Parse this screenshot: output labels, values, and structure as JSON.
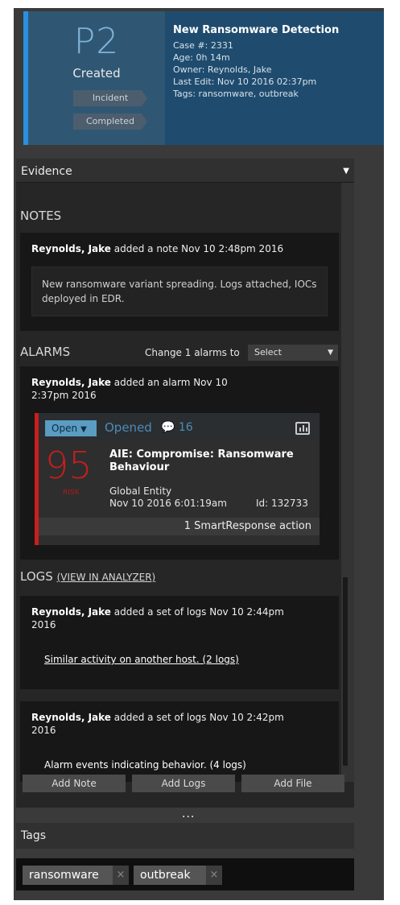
{
  "header": {
    "priority": "P2",
    "status": "Created",
    "chips": [
      "Incident",
      "Completed"
    ],
    "title": "New Ransomware Detection",
    "case_line": "Case #: 2331",
    "age_line": "Age: 0h 14m",
    "owner_line": "Owner: Reynolds, Jake",
    "last_edit_line": "Last Edit: Nov 10 2016 02:37pm",
    "tags_line": "Tags: ransomware, outbreak",
    "accent": "#2a8fe0"
  },
  "evidence": {
    "label": "Evidence",
    "notes_heading": "NOTES",
    "note": {
      "author": "Reynolds, Jake",
      "action": " added a note ",
      "when": "Nov 10 2:48pm 2016",
      "text": "New ransomware variant spreading. Logs attached, IOCs deployed in EDR."
    },
    "alarms_heading": "ALARMS",
    "change_label": "Change 1 alarms to",
    "select_value": "Select",
    "alarm_entry": {
      "author": "Reynolds, Jake",
      "action": " added an alarm ",
      "when": "Nov 10 2:37pm 2016"
    },
    "alarm": {
      "status_button": "Open",
      "opened_label": "Opened",
      "comment_count": "16",
      "risk": "95",
      "risk_label": "RISK",
      "title": "AIE: Compromise: Ransomware Behaviour",
      "entity": "Global Entity",
      "date": "Nov 10 2016 6:01:19am",
      "id": "Id: 132733",
      "action": "1 SmartResponse action",
      "risk_color": "#c11f1f"
    },
    "logs_heading": "LOGS",
    "logs_link": "(VIEW IN ANALYZER)",
    "logs": [
      {
        "author": "Reynolds, Jake",
        "action": " added a set of logs ",
        "when": "Nov 10 2:44pm 2016",
        "link": "Similar activity on another host. (2 logs)"
      },
      {
        "author": "Reynolds, Jake",
        "action": " added a set of logs ",
        "when": "Nov 10 2:42pm 2016",
        "link": "Alarm events indicating behavior. (4 logs)"
      }
    ]
  },
  "buttons": {
    "add_note": "Add Note",
    "add_logs": "Add Logs",
    "add_file": "Add File",
    "ellipsis": "..."
  },
  "tags": {
    "label": "Tags",
    "items": [
      "ransomware",
      "outbreak"
    ],
    "remove_glyph": "×"
  }
}
